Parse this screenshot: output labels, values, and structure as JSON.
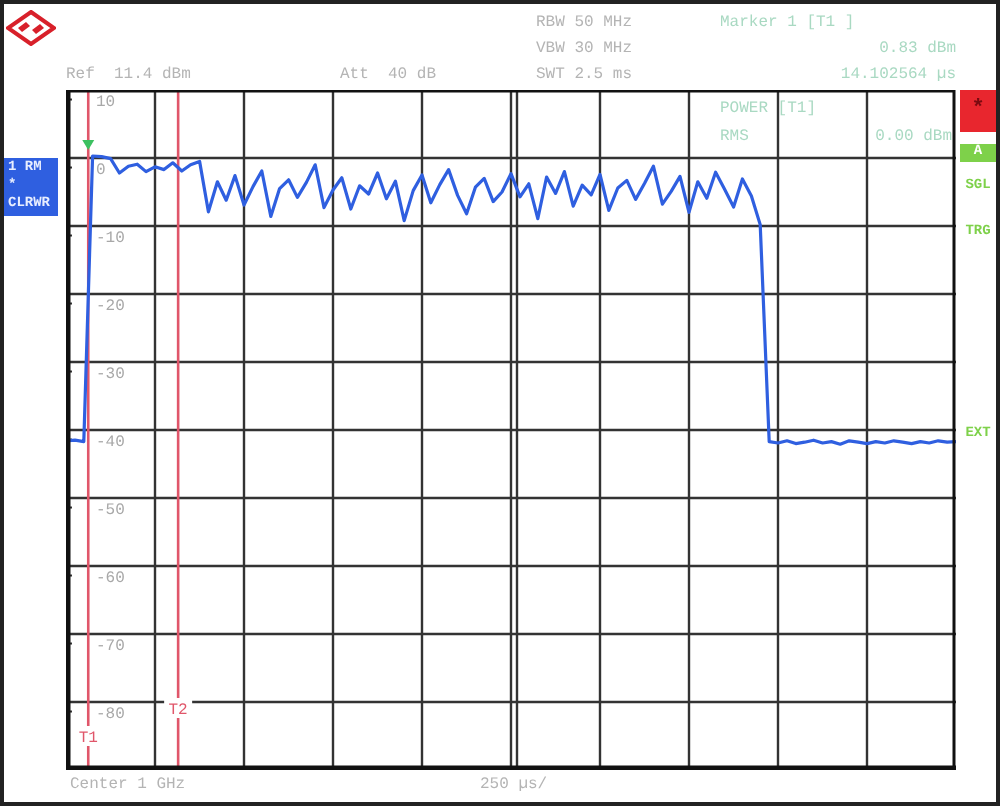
{
  "header": {
    "ref": "Ref  11.4 dBm",
    "att": "Att  40 dB",
    "rbw": "RBW 50 MHz",
    "vbw": "VBW 30 MHz",
    "swt": "SWT 2.5 ms"
  },
  "marker_info": {
    "title": "Marker 1 [T1 ]",
    "level": "0.83 dBm",
    "time": "14.102564 µs"
  },
  "measurement": {
    "title": "POWER [T1]",
    "detector": "RMS",
    "value": "0.00 dBm"
  },
  "trace_label": {
    "line_1": "1 RM *",
    "line_2": "CLRWR"
  },
  "status_flags": [
    {
      "text": "*",
      "kind": "alert"
    },
    {
      "text": "A",
      "kind": "box"
    },
    {
      "text": "SGL",
      "kind": "plain"
    },
    {
      "text": "TRG",
      "kind": "plain"
    },
    {
      "text": "EXT",
      "kind": "plain"
    }
  ],
  "plot": {
    "markers": [
      {
        "label": "T1"
      },
      {
        "label": "T2"
      }
    ],
    "chart_data": {
      "type": "line",
      "grid": true,
      "ylim": [
        -88.6,
        11.4
      ],
      "yticks": [
        10,
        0,
        -10,
        -20,
        -30,
        -40,
        -50,
        -60,
        -70,
        -80
      ],
      "series": [
        {
          "color": "#2f5fe0",
          "values": [
            -40.2,
            -40.1,
            -40.3,
            1.7,
            1.6,
            1.3,
            -0.8,
            0.2,
            0.5,
            -0.6,
            0.1,
            -0.3,
            0.7,
            -0.5,
            0.4,
            0.9,
            -6.5,
            -2.1,
            -4.8,
            -1.2,
            -5.5,
            -2.8,
            -0.5,
            -7.2,
            -3.1,
            -1.8,
            -4.4,
            -2.2,
            0.4,
            -5.9,
            -3.3,
            -1.5,
            -6.1,
            -2.7,
            -3.9,
            -0.8,
            -4.6,
            -2.0,
            -7.8,
            -3.4,
            -1.1,
            -5.2,
            -2.5,
            -0.3,
            -4.1,
            -6.8,
            -2.9,
            -1.6,
            -5.0,
            -3.6,
            -0.9,
            -4.3,
            -2.4,
            -7.5,
            -1.4,
            -3.8,
            -0.6,
            -5.7,
            -2.6,
            -4.0,
            -1.0,
            -6.3,
            -3.0,
            -1.9,
            -4.7,
            -2.3,
            0.2,
            -5.4,
            -3.5,
            -1.3,
            -6.6,
            -2.1,
            -4.5,
            -0.7,
            -3.2,
            -5.8,
            -1.7,
            -4.2,
            -8.4,
            -40.3,
            -40.5,
            -40.2,
            -40.6,
            -40.4,
            -40.1,
            -40.5,
            -40.3,
            -40.7,
            -40.2,
            -40.4,
            -40.6,
            -40.3,
            -40.5,
            -40.2,
            -40.4,
            -40.6,
            -40.3,
            -40.5,
            -40.2,
            -40.4,
            -40.3
          ]
        }
      ]
    }
  },
  "footer": {
    "center": "Center 1 GHz",
    "span_per_div": "250 µs/"
  }
}
